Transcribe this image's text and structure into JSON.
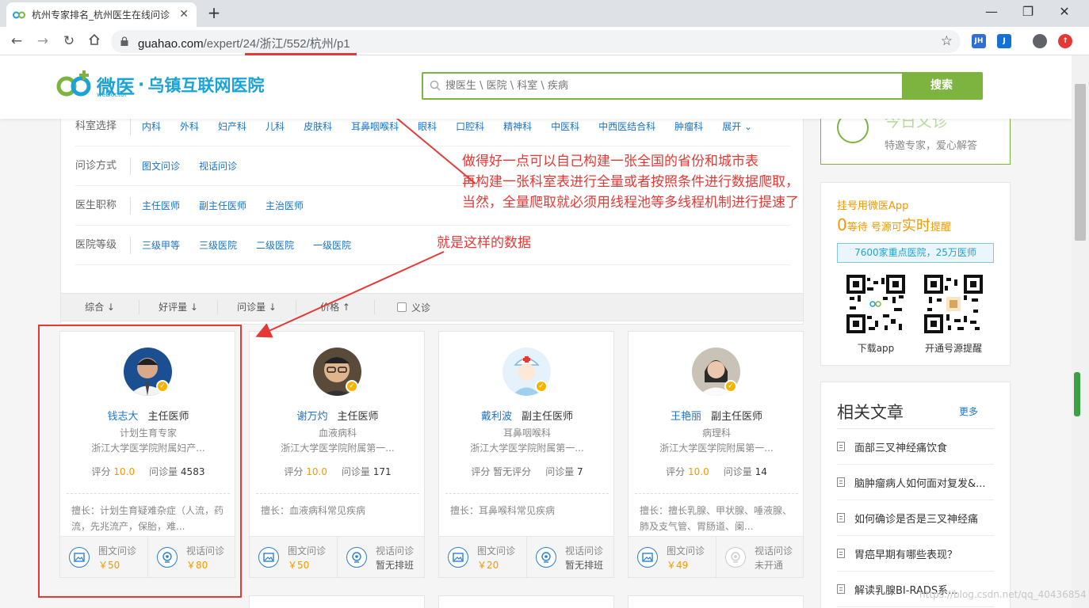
{
  "browser": {
    "tab_title": "杭州专家排名_杭州医生在线问诊",
    "url_host": "guahao.com",
    "url_path": "/expert/24/浙江/552/杭州/p1",
    "ext1": "JH",
    "ext2": "J"
  },
  "site": {
    "brand": "微医",
    "brand_sub": "weDoctor",
    "hospital": "乌镇互联网医院",
    "search_placeholder": "搜医生 \\ 医院 \\ 科室 \\ 疾病",
    "search_button": "搜索"
  },
  "filters": [
    {
      "label": "科室选择",
      "options": [
        "内科",
        "外科",
        "妇产科",
        "儿科",
        "皮肤科",
        "耳鼻咽喉科",
        "眼科",
        "口腔科",
        "精神科",
        "中医科",
        "中西医结合科",
        "肿瘤科",
        "展开"
      ]
    },
    {
      "label": "问诊方式",
      "options": [
        "图文问诊",
        "视话问诊"
      ]
    },
    {
      "label": "医生职称",
      "options": [
        "主任医师",
        "副主任医师",
        "主治医师"
      ]
    },
    {
      "label": "医院等级",
      "options": [
        "三级甲等",
        "三级医院",
        "二级医院",
        "一级医院"
      ]
    }
  ],
  "sort": {
    "items": [
      "综合 ↓",
      "好评量 ↓",
      "问诊量 ↓",
      "价格 ↑"
    ],
    "checkbox_label": "义诊"
  },
  "doctors": [
    {
      "name": "钱志大",
      "title": "主任医师",
      "dept": "计划生育专家",
      "hospital": "浙江大学医学院附属妇产...",
      "rating_label": "评分",
      "rating": "10.0",
      "volume_label": "问诊量",
      "volume": "4583",
      "skill": "擅长：计划生育疑难杂症（人流，药流，先兆流产，保胎，难...",
      "svc1_name": "图文问诊",
      "svc1_price": "￥50",
      "svc2_name": "视话问诊",
      "svc2_price": "￥80"
    },
    {
      "name": "谢万灼",
      "title": "主任医师",
      "dept": "血液病科",
      "hospital": "浙江大学医学院附属第一...",
      "rating_label": "评分",
      "rating": "10.0",
      "volume_label": "问诊量",
      "volume": "171",
      "skill": "擅长：血液病科常见疾病",
      "svc1_name": "图文问诊",
      "svc1_price": "￥50",
      "svc2_name": "视话问诊",
      "svc2_price": "暂无排班"
    },
    {
      "name": "戴利波",
      "title": "副主任医师",
      "dept": "耳鼻咽喉科",
      "hospital": "浙江大学医学院附属第一...",
      "rating_label": "评分",
      "rating": "暂无评分",
      "volume_label": "问诊量",
      "volume": "7",
      "skill": "擅长：耳鼻喉科常见疾病",
      "svc1_name": "图文问诊",
      "svc1_price": "￥20",
      "svc2_name": "视话问诊",
      "svc2_price": "暂无排班"
    },
    {
      "name": "王艳丽",
      "title": "副主任医师",
      "dept": "病理科",
      "hospital": "浙江大学医学院附属第一...",
      "rating_label": "评分",
      "rating": "10.0",
      "volume_label": "问诊量",
      "volume": "14",
      "skill": "擅长：擅长乳腺、甲状腺、唾液腺、肺及支气管、胃肠道、阑...",
      "svc1_name": "图文问诊",
      "svc1_price": "￥49",
      "svc2_name": "视话问诊",
      "svc2_price": "未开通"
    }
  ],
  "sidebar": {
    "promo_title": "今日义诊",
    "promo_sub": "特邀专家，爱心解答",
    "app_title": "挂号用微医App",
    "app_line_a": "0",
    "app_line_b": "等待 号源可",
    "app_line_c": "实时",
    "app_line_d": "提醒",
    "app_box": "7600家重点医院，25万医师",
    "qr1_label": "下载app",
    "qr2_label": "开通号源提醒",
    "articles_title": "相关文章",
    "articles_more": "更多",
    "articles": [
      "面部三叉神经痛饮食",
      "脑肿瘤病人如何面对复发&...",
      "如何确诊是否是三叉神经痛",
      "胃癌早期有哪些表现？",
      "解读乳腺BI-RADS系..."
    ]
  },
  "annotations": {
    "note_main": [
      "做得好一点可以自己构建一张全国的省份和城市表",
      "再构建一张科室表进行全量或者按照条件进行数据爬取，",
      "当然，全量爬取就必须用线程池等多线程机制进行提速了"
    ],
    "note_data": "就是这样的数据",
    "watermark": "https://blog.csdn.net/qq_40436854"
  },
  "colors": {
    "accent_green": "#7db43f",
    "link_blue": "#1a73c8",
    "annot_red": "#e53935",
    "price_orange": "#f39800"
  }
}
